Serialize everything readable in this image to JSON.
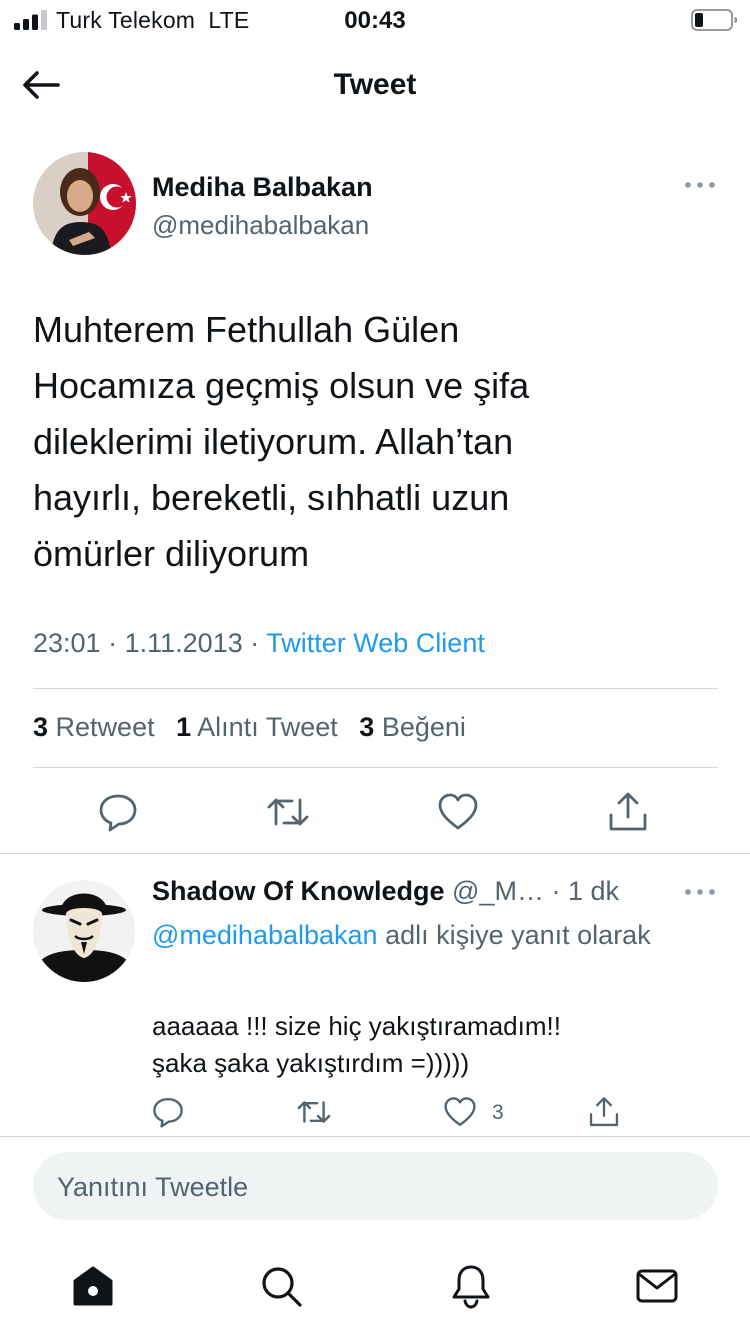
{
  "status_bar": {
    "carrier": "Turk Telekom",
    "network": "LTE",
    "time": "00:43"
  },
  "header": {
    "title": "Tweet",
    "back_icon": "arrow-left-icon"
  },
  "tweet": {
    "author": {
      "name": "Mediha Balbakan",
      "handle": "@medihabalbakan"
    },
    "text_lines": [
      "Muhterem Fethullah Gülen",
      "Hocamıza geçmiş olsun ve şifa",
      "dileklerimi iletiyorum. Allah’tan",
      "hayırlı, bereketli, sıhhatli uzun",
      "ömürler diliyorum"
    ],
    "time": "23:01",
    "date": "1.11.2013",
    "separator": "·",
    "source": "Twitter Web Client",
    "stats": [
      {
        "count": "3",
        "label": "Retweet"
      },
      {
        "count": "1",
        "label": "Alıntı Tweet"
      },
      {
        "count": "3",
        "label": "Beğeni"
      }
    ]
  },
  "reply": {
    "author": {
      "name": "Shadow Of Knowledge",
      "handle_truncated": "@_M…",
      "age": "1 dk"
    },
    "replying_to_mention": "@medihabalbakan",
    "replying_to_suffix": "adlı kişiye yanıt olarak",
    "text_lines": [
      "aaaaaa !!! size hiç yakıştıramadım!!",
      "şaka şaka yakıştırdım =)))))"
    ],
    "like_count": "3"
  },
  "composer": {
    "placeholder": "Yanıtını Tweetle"
  },
  "icons": {
    "more": "more-horizontal-icon",
    "reply": "reply-bubble-icon",
    "retweet": "retweet-icon",
    "like": "heart-icon",
    "share": "share-icon",
    "nav": [
      "home-icon",
      "search-icon",
      "notifications-bell-icon",
      "messages-envelope-icon"
    ]
  },
  "colors": {
    "accent": "#1d9bf0",
    "text_primary": "#0f1419",
    "text_secondary": "#536471",
    "divider": "#cfd9de",
    "composer_bg": "#eff3f4"
  }
}
